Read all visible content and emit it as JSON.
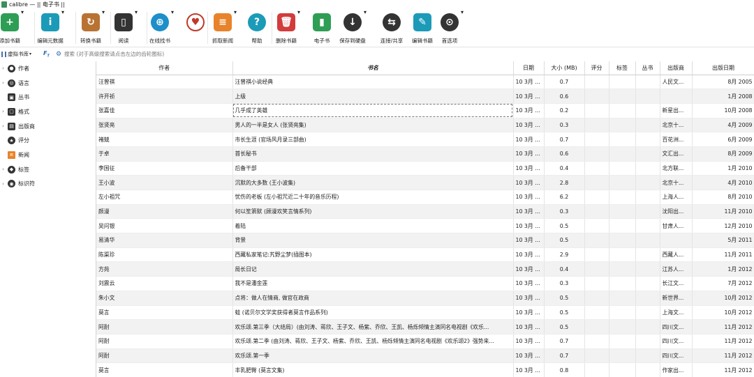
{
  "window": {
    "title": "calibre — || 电子书 ||"
  },
  "toolbar": {
    "items": [
      {
        "label": "添加书籍",
        "icon": "add-book-icon",
        "color": "#2e9e54"
      },
      {
        "label": "编辑元数据",
        "icon": "edit-metadata-icon",
        "color": "#1b9bb8"
      },
      {
        "label": "转换书籍",
        "icon": "convert-book-icon",
        "color": "#b87333"
      },
      {
        "label": "阅读",
        "icon": "read-book-icon",
        "color": "#333333"
      },
      {
        "label": "在线找书",
        "icon": "globe-icon",
        "color": "#1e8fc9"
      },
      {
        "label": "",
        "icon": "heart-icon",
        "color": "#c0392b"
      },
      {
        "label": "抓取新闻",
        "icon": "fetch-news-icon",
        "color": "#e8832a"
      },
      {
        "label": "帮助",
        "icon": "help-icon",
        "color": "#1b9bb8"
      },
      {
        "label": "删除书籍",
        "icon": "remove-book-icon",
        "color": "#d23c3c"
      },
      {
        "label": "电子书",
        "icon": "device-icon",
        "color": "#2e9e54"
      },
      {
        "label": "保存到硬盘",
        "icon": "save-disk-icon",
        "color": "#333333"
      },
      {
        "label": "连接/共享",
        "icon": "connect-share-icon",
        "color": "#333333"
      },
      {
        "label": "编辑书籍",
        "icon": "edit-book-icon",
        "color": "#1b9bb8"
      },
      {
        "label": "首选项",
        "icon": "preferences-icon",
        "color": "#333333"
      }
    ]
  },
  "search": {
    "virtual_library_label": "虚拟书库",
    "placeholder": "搜索 (对于高级搜索请点击左边的齿轮图标)"
  },
  "sidebar": {
    "items": [
      {
        "label": "作者",
        "icon": "author-icon",
        "expandable": true
      },
      {
        "label": "语言",
        "icon": "language-icon",
        "expandable": true
      },
      {
        "label": "丛书",
        "icon": "series-icon",
        "expandable": false
      },
      {
        "label": "格式",
        "icon": "format-icon",
        "expandable": true
      },
      {
        "label": "出版商",
        "icon": "publisher-icon",
        "expandable": true
      },
      {
        "label": "评分",
        "icon": "rating-icon",
        "expandable": false
      },
      {
        "label": "新闻",
        "icon": "news-icon",
        "expandable": false
      },
      {
        "label": "标签",
        "icon": "tag-icon",
        "expandable": true
      },
      {
        "label": "标识符",
        "icon": "identifier-icon",
        "expandable": true
      }
    ]
  },
  "table": {
    "columns": [
      "作者",
      "书名",
      "日期",
      "大小 (MB)",
      "评分",
      "标签",
      "丛书",
      "出版商",
      "出版日期"
    ],
    "sorted_column": "书名",
    "rows": [
      [
        "汪曾祺",
        "汪曾祺小说经典",
        "10 3月 2...",
        "0.7",
        "",
        "",
        "",
        "人民文...",
        "8月 2005"
      ],
      [
        "许开祯",
        "上级",
        "10 3月 2...",
        "0.6",
        "",
        "",
        "",
        "",
        "1月 2008"
      ],
      [
        "张嘉佳",
        "几乎成了英雄",
        "10 3月 2...",
        "0.2",
        "",
        "",
        "",
        "新星出...",
        "10月 2008"
      ],
      [
        "张贤亮",
        "男人的一半是女人 (张贤亮集)",
        "10 3月 2...",
        "0.3",
        "",
        "",
        "",
        "北京十...",
        "4月 2009"
      ],
      [
        "褚兢",
        "市长生涯 (官场风月录三部曲)",
        "10 3月 2...",
        "0.7",
        "",
        "",
        "",
        "百花洲...",
        "6月 2009"
      ],
      [
        "于卓",
        "首长秘书",
        "10 3月 2...",
        "0.6",
        "",
        "",
        "",
        "文汇出...",
        "8月 2009"
      ],
      [
        "李国征",
        "后备干部",
        "10 3月 2...",
        "0.4",
        "",
        "",
        "",
        "北方联...",
        "1月 2010"
      ],
      [
        "王小波",
        "沉默的大多数 (王小波集)",
        "10 3月 2...",
        "2.8",
        "",
        "",
        "",
        "北京十...",
        "4月 2010"
      ],
      [
        "左小祖咒",
        "忧伤的老板 (左小祖咒近二十年的音乐历程)",
        "10 3月 2...",
        "6.2",
        "",
        "",
        "",
        "上海人...",
        "8月 2010"
      ],
      [
        "颜漫",
        "何以笙箫默 (顾漫欢笑言情系列)",
        "10 3月 2...",
        "0.3",
        "",
        "",
        "",
        "沈阳出...",
        "11月 2010"
      ],
      [
        "吴问银",
        "着陆",
        "10 3月 2...",
        "0.5",
        "",
        "",
        "",
        "甘肃人...",
        "12月 2010"
      ],
      [
        "易清华",
        "背景",
        "10 3月 2...",
        "0.5",
        "",
        "",
        "",
        "",
        "5月 2011"
      ],
      [
        "陈渠珍",
        "西藏私家笔记:艽野尘梦(插图本)",
        "10 3月 2...",
        "2.9",
        "",
        "",
        "",
        "西藏人...",
        "11月 2011"
      ],
      [
        "方苑",
        "局长日记",
        "10 3月 2...",
        "0.4",
        "",
        "",
        "",
        "江苏人...",
        "1月 2012"
      ],
      [
        "刘震云",
        "我不是潘金莲",
        "10 3月 2...",
        "0.3",
        "",
        "",
        "",
        "长江文...",
        "7月 2012"
      ],
      [
        "朱小文",
        "点将：做人在情商, 做官在政商",
        "10 3月 2...",
        "0.5",
        "",
        "",
        "",
        "新世界...",
        "10月 2012"
      ],
      [
        "莫言",
        "蛙 (诺贝尔文学奖获得者莫言作品系列)",
        "10 3月 2...",
        "0.5",
        "",
        "",
        "",
        "上海文...",
        "10月 2012"
      ],
      [
        "阿耐",
        "欢乐颂.第三季（大结局）(由刘涛、蒋欣、王子文、杨紫、乔欣、王凯、杨烁倾情主演同名电视剧《欢乐...",
        "10 3月 2...",
        "0.5",
        "",
        "",
        "",
        "四川文...",
        "11月 2012"
      ],
      [
        "阿耐",
        "欢乐颂.第二季 (由刘涛、蒋欣、王子文、杨紫、乔欣、王凯、杨烁倾情主演同名电视剧《欢乐颂2》强势来...",
        "10 3月 2...",
        "0.7",
        "",
        "",
        "",
        "四川文...",
        "11月 2012"
      ],
      [
        "阿耐",
        "欢乐颂.第一季",
        "10 3月 2...",
        "0.7",
        "",
        "",
        "",
        "四川文...",
        "11月 2012"
      ],
      [
        "莫言",
        "丰乳肥臀 (莫言文集)",
        "10 3月 2...",
        "0.8",
        "",
        "",
        "",
        "作家出...",
        "11月 2012"
      ]
    ]
  }
}
